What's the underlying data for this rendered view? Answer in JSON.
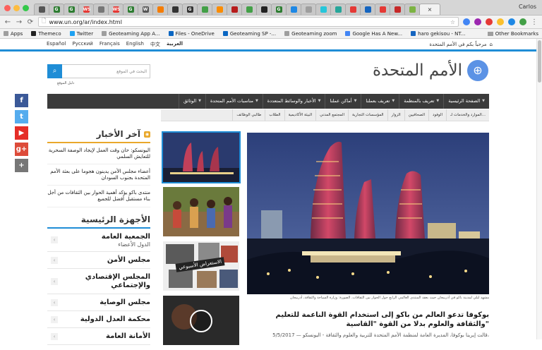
{
  "browser": {
    "user": "Carlos",
    "url": "www.un.org/ar/index.html",
    "tabs": [
      {
        "fav": "",
        "color": "#555555"
      },
      {
        "fav": "G",
        "color": "#2e7d32"
      },
      {
        "fav": "G",
        "color": "#2e7d32"
      },
      {
        "fav": "WS",
        "color": "#e53935"
      },
      {
        "fav": "",
        "color": "#777777"
      },
      {
        "fav": "WS",
        "color": "#e53935"
      },
      {
        "fav": "G",
        "color": "#2e7d32"
      },
      {
        "fav": "W",
        "color": "#555555"
      },
      {
        "fav": "",
        "color": "#f57c00"
      },
      {
        "fav": "",
        "color": "#333333"
      },
      {
        "fav": "G",
        "color": "#333333"
      },
      {
        "fav": "",
        "color": "#43a047"
      },
      {
        "fav": "",
        "color": "#fb8c00"
      },
      {
        "fav": "",
        "color": "#b71c1c"
      },
      {
        "fav": "",
        "color": "#43a047"
      },
      {
        "fav": "",
        "color": "#222222"
      },
      {
        "fav": "G",
        "color": "#2e7d32"
      },
      {
        "fav": "",
        "color": "#1e88e5"
      },
      {
        "fav": "",
        "color": "#9e9e9e"
      },
      {
        "fav": "",
        "color": "#26c6da"
      },
      {
        "fav": "",
        "color": "#26a69a"
      },
      {
        "fav": "",
        "color": "#e53935"
      },
      {
        "fav": "",
        "color": "#1565c0"
      },
      {
        "fav": "",
        "color": "#e53935"
      },
      {
        "fav": "",
        "color": "#c62828"
      },
      {
        "fav": "",
        "color": "#7cb342"
      }
    ],
    "bookmarks": [
      {
        "label": "Apps",
        "color": "#9e9e9e"
      },
      {
        "label": "Themeco",
        "color": "#222222"
      },
      {
        "label": "Twitter",
        "color": "#1da1f2"
      },
      {
        "label": "Geoteaming App A...",
        "color": "#9e9e9e"
      },
      {
        "label": "Files - OneDrive",
        "color": "#0a66c2"
      },
      {
        "label": "Geoteaming SP -...",
        "color": "#0a66c2"
      },
      {
        "label": "Geoteaming zoom",
        "color": "#9e9e9e"
      },
      {
        "label": "Google Has A New...",
        "color": "#4285f4"
      },
      {
        "label": "haro gekisou - NT...",
        "color": "#1565c0"
      }
    ],
    "other_bookmarks": "Other Bookmarks"
  },
  "site": {
    "languages": [
      "Español",
      "Русский",
      "Français",
      "English",
      "中文",
      "العربية"
    ],
    "welcome": "مرحباً بكم في الأمم المتحدة",
    "brand_name": "الأمم المتحدة",
    "search_placeholder": "البحث في الموقع",
    "search_guide": "دليل الموقع",
    "main_nav": [
      "الصفحة الرئيسية",
      "تعريف بالمنظمة",
      "تعريف بعملنا",
      "أماكن عملنا",
      "الأخبار والوسائط المتعددة",
      "مناسبات الأمم المتحدة",
      "الوثائق"
    ],
    "sub_nav": [
      "الموارد والخدمات لـ...",
      "الوفود",
      "الصحافيين",
      "الزوار",
      "المؤسسات التجارية",
      "المجتمع المدني",
      "البيئة الأكاديمية",
      "الطلاب",
      "طالبي الوظائف"
    ],
    "social": [
      {
        "label": "f",
        "color": "#3b5998"
      },
      {
        "label": "t",
        "color": "#55acee"
      },
      {
        "label": "▶",
        "color": "#e52d27"
      },
      {
        "label": "g+",
        "color": "#dd4b39"
      },
      {
        "label": "+",
        "color": "#777777"
      }
    ],
    "news_title": "آخر الأخبار",
    "news": [
      "اليونسكو: حان وقت العمل لإيجاد الوصفة السحرية للتعايش السلمي",
      "أعضاء مجلس الأمن يدينون هجوما على بعثة الأمم المتحدة بجنوب السودان",
      "منتدى باكو يؤكد أهمية الحوار بين الثقافات من أجل بناء مستقبل أفضل للجميع"
    ],
    "organs_title": "الأجهزة الرئيسية",
    "organs": [
      {
        "name": "الجمعية العامة",
        "sub": "الدول الأعضاء"
      },
      {
        "name": "مجلس الأمن",
        "sub": ""
      },
      {
        "name": "المجلس الإقتصادي والإجتماعي",
        "sub": ""
      },
      {
        "name": "مجلس الوصاية",
        "sub": ""
      },
      {
        "name": "محكمة العدل الدولية",
        "sub": ""
      },
      {
        "name": "الأمانة العامة",
        "sub": ""
      }
    ],
    "weekly_label": "الاستعراض الأسبوعي",
    "hero_caption": "مشهد ليلي لمدينة باكو في أذربيجان حيث يعقد المنتدى العالمي الرابع حول الحوار بين الثقافات. الصورة: وزارة السياحة والثقافة، أذربيجان",
    "headline": "بوكوفا تدعو العالم من باكو إلى استخدام القوة الناعمة للتعليم والثقافة والعلوم بدلا من القوة \"القاسية\"",
    "lede": "5/5/2017 — قالت إيرينا بوكوفا، المديرة العامة لمنظمة الأمم المتحدة للتربية والعلوم والثقافة - اليونسكو،",
    "colors": {
      "accent": "#1f8dd6",
      "nav": "#3b3b3b",
      "news_accent": "#e9a82b"
    }
  }
}
